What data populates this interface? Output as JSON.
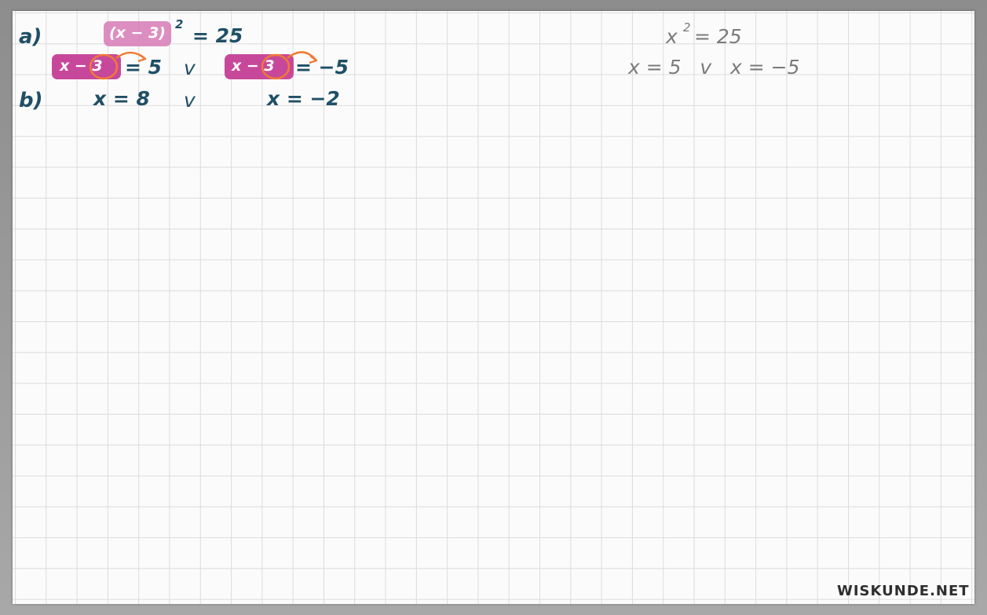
{
  "exercise_a": {
    "label": "a)",
    "equation_box": "(x − 3)",
    "equation_exponent": "2",
    "equation_rhs": "= 25",
    "split_left_box": "x − 3",
    "split_left_rhs": "= 5",
    "split_or": "v",
    "split_right_box": "x − 3",
    "split_right_rhs": "= −5"
  },
  "exercise_b": {
    "label": "b)",
    "left_solution": "x = 8",
    "or": "v",
    "right_solution": "x = −2"
  },
  "side_note": {
    "line1_base": "x",
    "line1_exponent": "2",
    "line1_rhs": "= 25",
    "line2": "x = 5   v   x = −5"
  },
  "watermark": "WISKUNDE.NET",
  "colors": {
    "ink": "#1f4f66",
    "pencil_gray": "#7b7b7b",
    "highlight_pink": "#c7489b",
    "highlight_pink_light": "#d77ab5",
    "annotation_orange": "#ee7b35"
  }
}
